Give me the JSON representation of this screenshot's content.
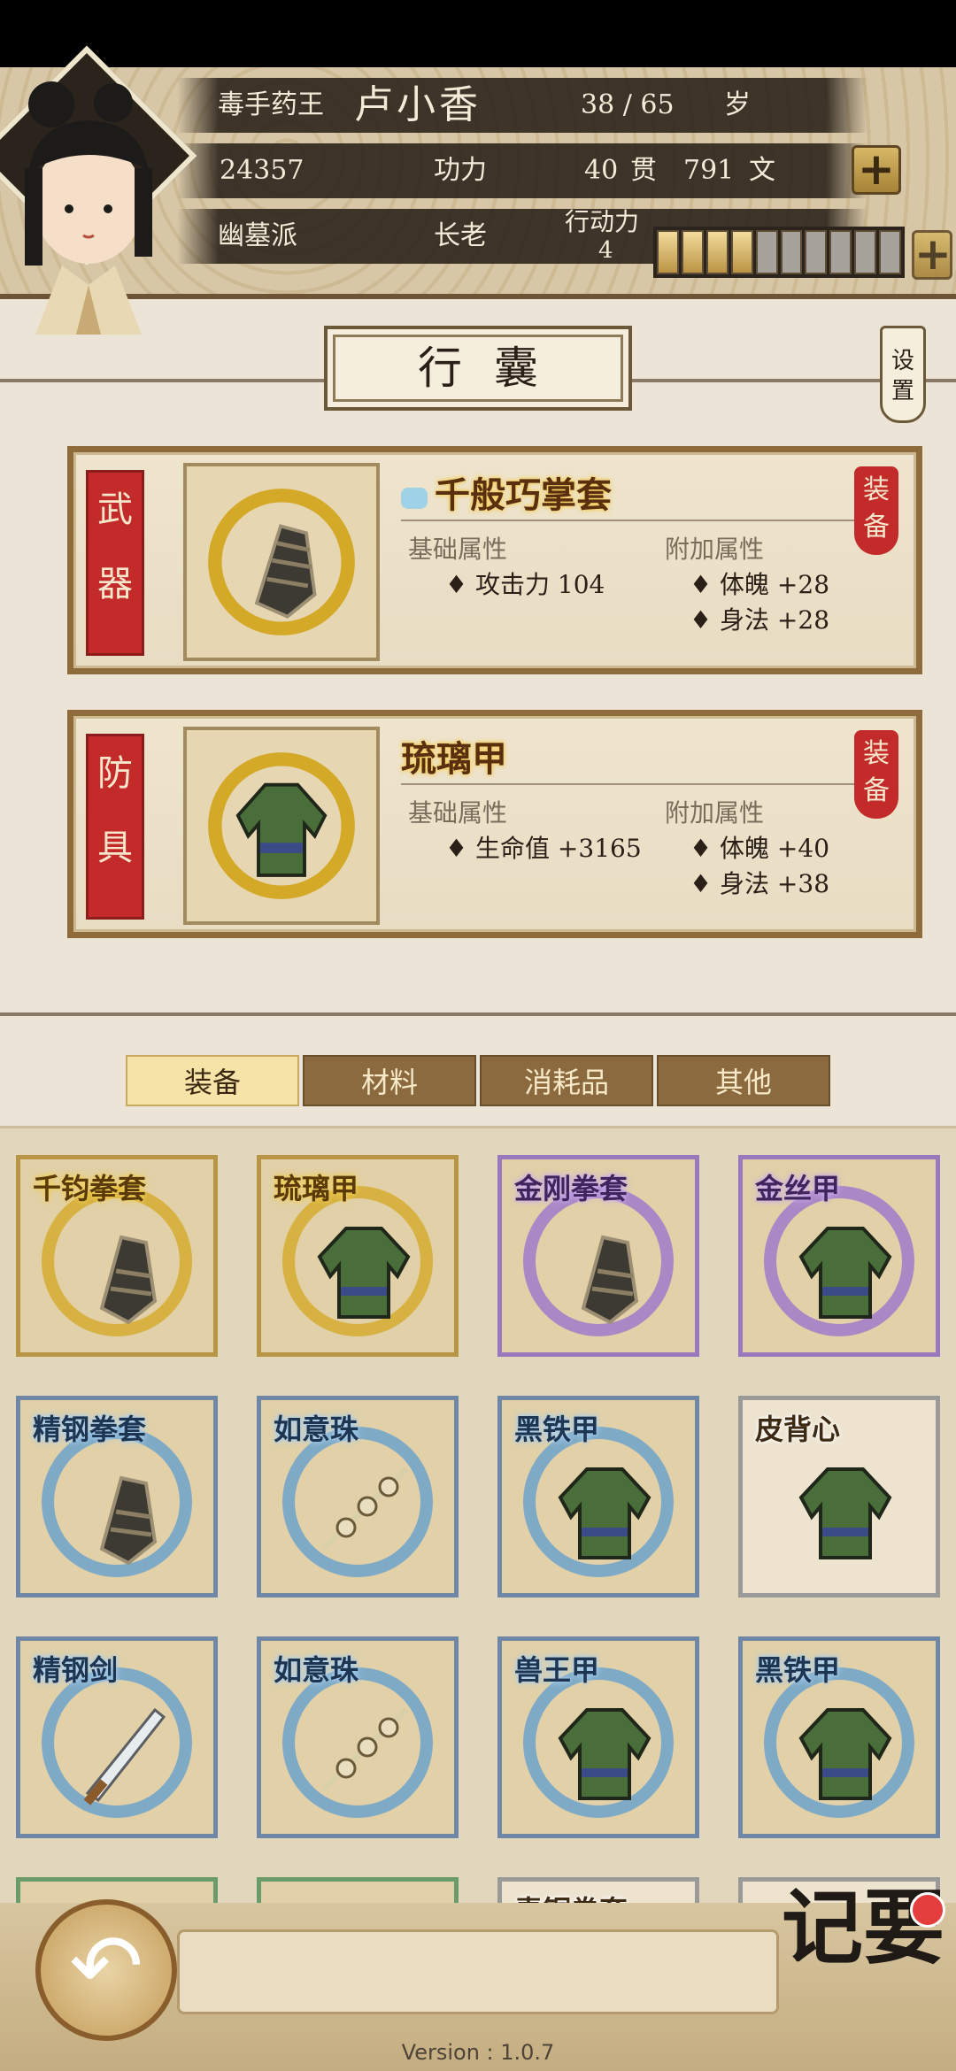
{
  "header": {
    "title_prefix": "毒手药王",
    "name": "卢小香",
    "age": "38 / 65",
    "age_unit": "岁",
    "power_value": "24357",
    "power_label": "功力",
    "money_guan": "40",
    "money_guan_unit": "贯",
    "money_wen": "791",
    "money_wen_unit": "文",
    "sect": "幽墓派",
    "rank": "长老",
    "action_label": "行动力",
    "action_value": "4",
    "action_bar_filled": 4,
    "action_bar_total": 10
  },
  "title": "行囊",
  "settings_label": "设置",
  "equipped": [
    {
      "slot": [
        "武",
        "器"
      ],
      "name": "千般巧掌套",
      "base_label": "基础属性",
      "extra_label": "附加属性",
      "base_stats": [
        "攻击力 104"
      ],
      "extra_stats": [
        "体魄 +28",
        "身法 +28"
      ],
      "badge": "装备"
    },
    {
      "slot": [
        "防",
        "具"
      ],
      "name": "琉璃甲",
      "base_label": "基础属性",
      "extra_label": "附加属性",
      "base_stats": [
        "生命值 +3165"
      ],
      "extra_stats": [
        "体魄 +40",
        "身法 +38"
      ],
      "badge": "装备"
    }
  ],
  "tabs": [
    "装备",
    "材料",
    "消耗品",
    "其他"
  ],
  "active_tab": 0,
  "items": [
    {
      "name": "千钧拳套",
      "quality": "gold",
      "icon": "gauntlet-icon"
    },
    {
      "name": "琉璃甲",
      "quality": "gold",
      "icon": "armor-icon"
    },
    {
      "name": "金刚拳套",
      "quality": "purple",
      "icon": "gauntlet-icon"
    },
    {
      "name": "金丝甲",
      "quality": "purple",
      "icon": "armor-icon"
    },
    {
      "name": "精钢拳套",
      "quality": "blue",
      "icon": "gauntlet-icon"
    },
    {
      "name": "如意珠",
      "quality": "blue",
      "icon": "prayer-beads-icon"
    },
    {
      "name": "黑铁甲",
      "quality": "blue",
      "icon": "armor-icon"
    },
    {
      "name": "皮背心",
      "quality": "white",
      "icon": "armor-icon"
    },
    {
      "name": "精钢剑",
      "quality": "blue",
      "icon": "sword-icon"
    },
    {
      "name": "如意珠",
      "quality": "blue",
      "icon": "prayer-beads-icon"
    },
    {
      "name": "兽王甲",
      "quality": "blue",
      "icon": "armor-icon"
    },
    {
      "name": "黑铁甲",
      "quality": "blue",
      "icon": "armor-icon"
    },
    {
      "name": "",
      "quality": "green",
      "icon": "sword-icon"
    },
    {
      "name": "",
      "quality": "green",
      "icon": "armor-icon"
    },
    {
      "name": "青铜拳套",
      "quality": "white",
      "icon": "gauntlet-icon"
    },
    {
      "name": "",
      "quality": "white",
      "icon": "armor-icon"
    }
  ],
  "bottom": {
    "back_icon": "back-arrow-icon",
    "jiyao_label": "记要",
    "version": "Version : 1.0.7"
  },
  "colors": {
    "gold": "#b89545",
    "purple": "#9a78bd",
    "blue": "#6f86a5",
    "red_badge": "#c32a2a"
  }
}
